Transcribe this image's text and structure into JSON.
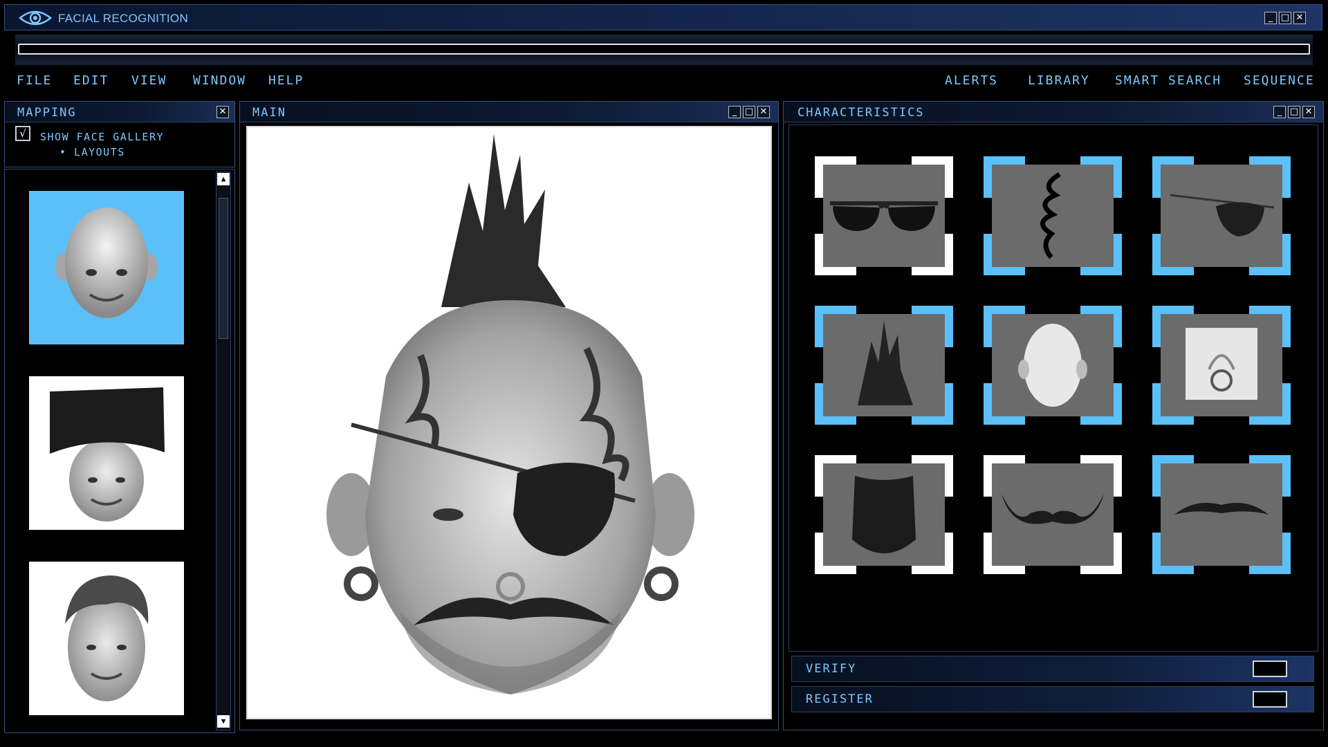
{
  "app": {
    "title": "FACIAL RECOGNITION"
  },
  "menu_left": [
    "FILE",
    "EDIT",
    "VIEW",
    "WINDOW",
    "HELP"
  ],
  "menu_right": [
    "ALERTS",
    "LIBRARY",
    "SMART SEARCH",
    "SEQUENCE"
  ],
  "mapping": {
    "title": "MAPPING",
    "checkbox_label": "SHOW FACE GALLERY",
    "checkbox_checked": true,
    "checkbox_mark": "√",
    "sub_item": "• LAYOUTS",
    "thumbnails": [
      {
        "name": "bald-face",
        "selected": true
      },
      {
        "name": "flat-top-face",
        "selected": false
      },
      {
        "name": "pompadour-face",
        "selected": false
      }
    ]
  },
  "main": {
    "title": "MAIN"
  },
  "characteristics": {
    "title": "CHARACTERISTICS",
    "items": [
      {
        "name": "sunglasses",
        "selected": true
      },
      {
        "name": "tribal-tattoo",
        "selected": false
      },
      {
        "name": "eye-patch",
        "selected": false
      },
      {
        "name": "mohawk",
        "selected": false
      },
      {
        "name": "bald-head",
        "selected": false
      },
      {
        "name": "septum-piercing",
        "selected": false
      },
      {
        "name": "full-beard",
        "selected": true
      },
      {
        "name": "handlebar-mustache",
        "selected": true
      },
      {
        "name": "thin-mustache",
        "selected": false
      }
    ]
  },
  "actions": {
    "verify": "VERIFY",
    "register": "REGISTER"
  },
  "window_buttons": {
    "minimize": "_",
    "maximize": "□",
    "close": "✕"
  },
  "colors": {
    "accent": "#5bc0f8",
    "selected_white": "#ffffff",
    "panel_bg": "#000000",
    "title_text": "#7cc8ff"
  },
  "icons": [
    "eye-logo-icon",
    "minimize-icon",
    "maximize-icon",
    "close-icon",
    "scroll-up-icon",
    "scroll-down-icon",
    "checkbox-icon"
  ]
}
